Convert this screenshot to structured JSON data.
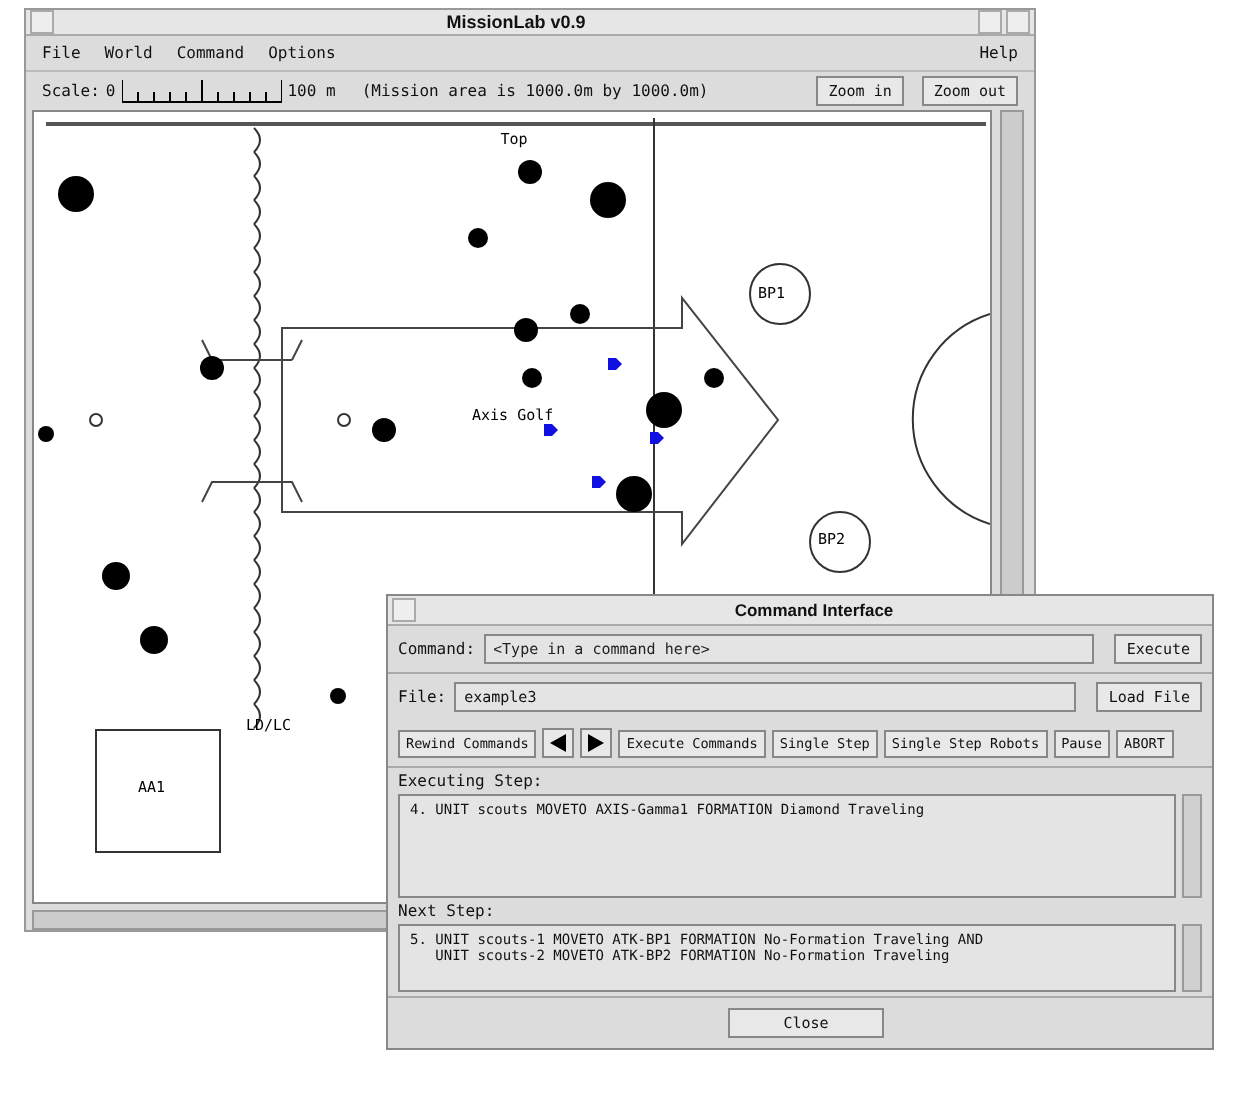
{
  "window": {
    "title": "MissionLab  v0.9"
  },
  "menu": [
    {
      "label": "File"
    },
    {
      "label": "World"
    },
    {
      "label": "Command"
    },
    {
      "label": "Options"
    }
  ],
  "help": "Help",
  "scale": {
    "label": "Scale:",
    "start": "0",
    "end": "100 m",
    "note": "(Mission area is 1000.0m by 1000.0m)"
  },
  "zoom_buttons": [
    "Zoom in",
    "Zoom out"
  ],
  "map_labels": {
    "top": "Top",
    "bp1": "BP1",
    "bp2": "BP2",
    "axis": "Axis Golf",
    "ldlc": "LD/LC",
    "aa1": "AA1"
  },
  "dialog": {
    "title": "Command Interface",
    "command_label": "Command:",
    "command_placeholder": "<Type in a command here>",
    "execute": "Execute",
    "file_label": "File:",
    "file_value": "example3",
    "load": "Load File",
    "buttons": [
      {
        "kind": "text",
        "label": "Rewind Commands"
      },
      {
        "kind": "back"
      },
      {
        "kind": "forward"
      },
      {
        "kind": "text",
        "label": "Execute Commands"
      },
      {
        "kind": "text",
        "label": "Single Step"
      },
      {
        "kind": "text",
        "label": "Single Step Robots"
      },
      {
        "kind": "text",
        "label": "Pause"
      },
      {
        "kind": "text",
        "label": "ABORT"
      }
    ],
    "executing_label": "Executing Step:",
    "executing_lines": [
      "4. UNIT scouts MOVETO AXIS-Gamma1 FORMATION Diamond Traveling"
    ],
    "next_label": "Next Step:",
    "next_lines": [
      "5. UNIT scouts-1 MOVETO ATK-BP1 FORMATION No-Formation Traveling AND",
      "   UNIT scouts-2 MOVETO ATK-BP2 FORMATION No-Formation Traveling"
    ],
    "close": "Close"
  }
}
